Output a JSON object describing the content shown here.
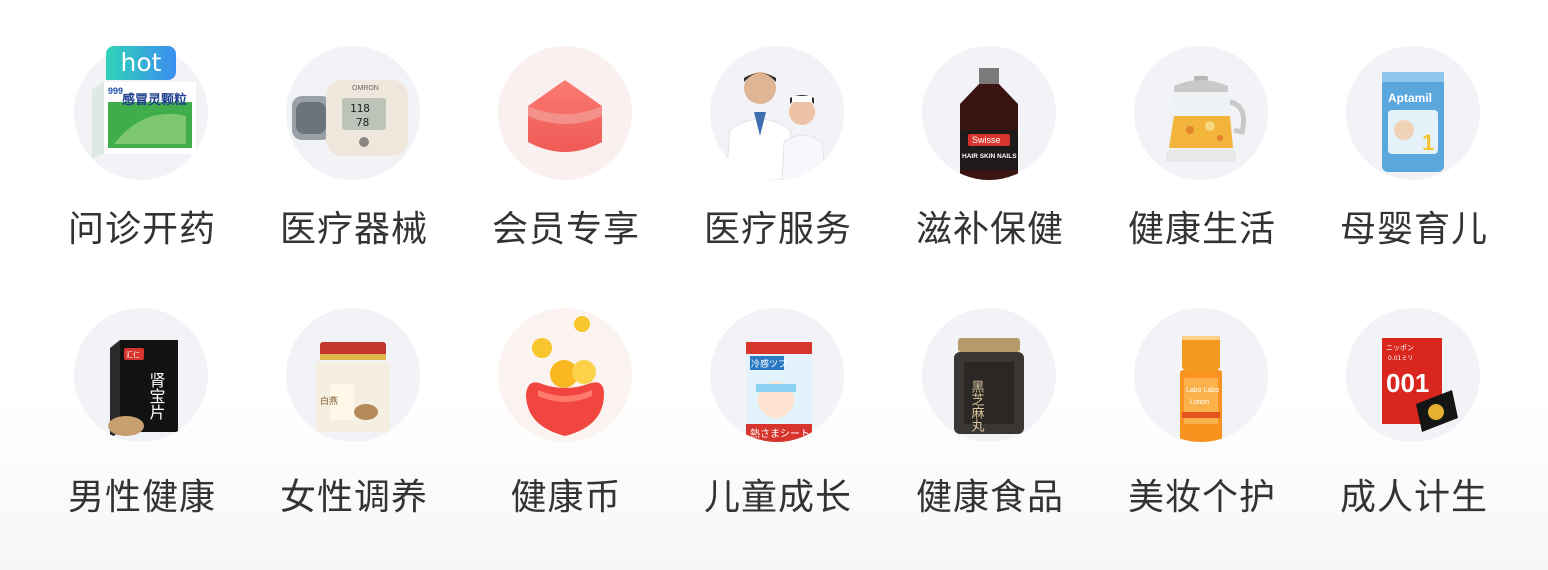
{
  "categories": [
    {
      "label": "问诊开药",
      "icon": "cold-granules-box-icon"
    },
    {
      "label": "医疗器械",
      "icon": "blood-pressure-monitor-icon"
    },
    {
      "label": "会员专享",
      "icon": "member-red-pentagon-icon"
    },
    {
      "label": "医疗服务",
      "icon": "doctor-nurse-icon"
    },
    {
      "label": "滋补保健",
      "icon": "swisse-bottle-icon"
    },
    {
      "label": "健康生活",
      "icon": "health-kettle-icon"
    },
    {
      "label": "母婴育儿",
      "icon": "aptamil-formula-can-icon"
    },
    {
      "label": "男性健康",
      "icon": "kidney-tablets-box-icon"
    },
    {
      "label": "女性调养",
      "icon": "birds-nest-jar-icon"
    },
    {
      "label": "健康币",
      "icon": "coin-pouch-icon"
    },
    {
      "label": "儿童成长",
      "icon": "cooling-patch-pack-icon"
    },
    {
      "label": "健康食品",
      "icon": "black-sesame-pills-jar-icon"
    },
    {
      "label": "美妆个护",
      "icon": "lotion-bottle-icon"
    },
    {
      "label": "成人计生",
      "icon": "okamoto-box-icon"
    }
  ],
  "hot_badge": "hot",
  "product_text": {
    "cold": {
      "brand": "999",
      "name": "感冒灵颗粒"
    },
    "bp": {
      "brand": "OMRON",
      "sys": "118",
      "dia": "78"
    },
    "swisse": {
      "brand": "Swisse",
      "line": "HAIR SKIN NAILS"
    },
    "aptamil": {
      "brand": "Aptamil",
      "stage": "1"
    },
    "kidney": {
      "brand": "汇仁",
      "name": "肾宝片"
    },
    "nest": {
      "name": "白燕"
    },
    "patch": {
      "name": "冷感ツブ",
      "sub": "熱さまシート"
    },
    "sesame": {
      "name": "黑芝麻丸"
    },
    "lotion": {
      "brand": "Labo Labo",
      "name": "Lotion"
    },
    "condom": {
      "brand": "ニッポン",
      "model": "001",
      "sub": "0.01ミリ"
    }
  }
}
